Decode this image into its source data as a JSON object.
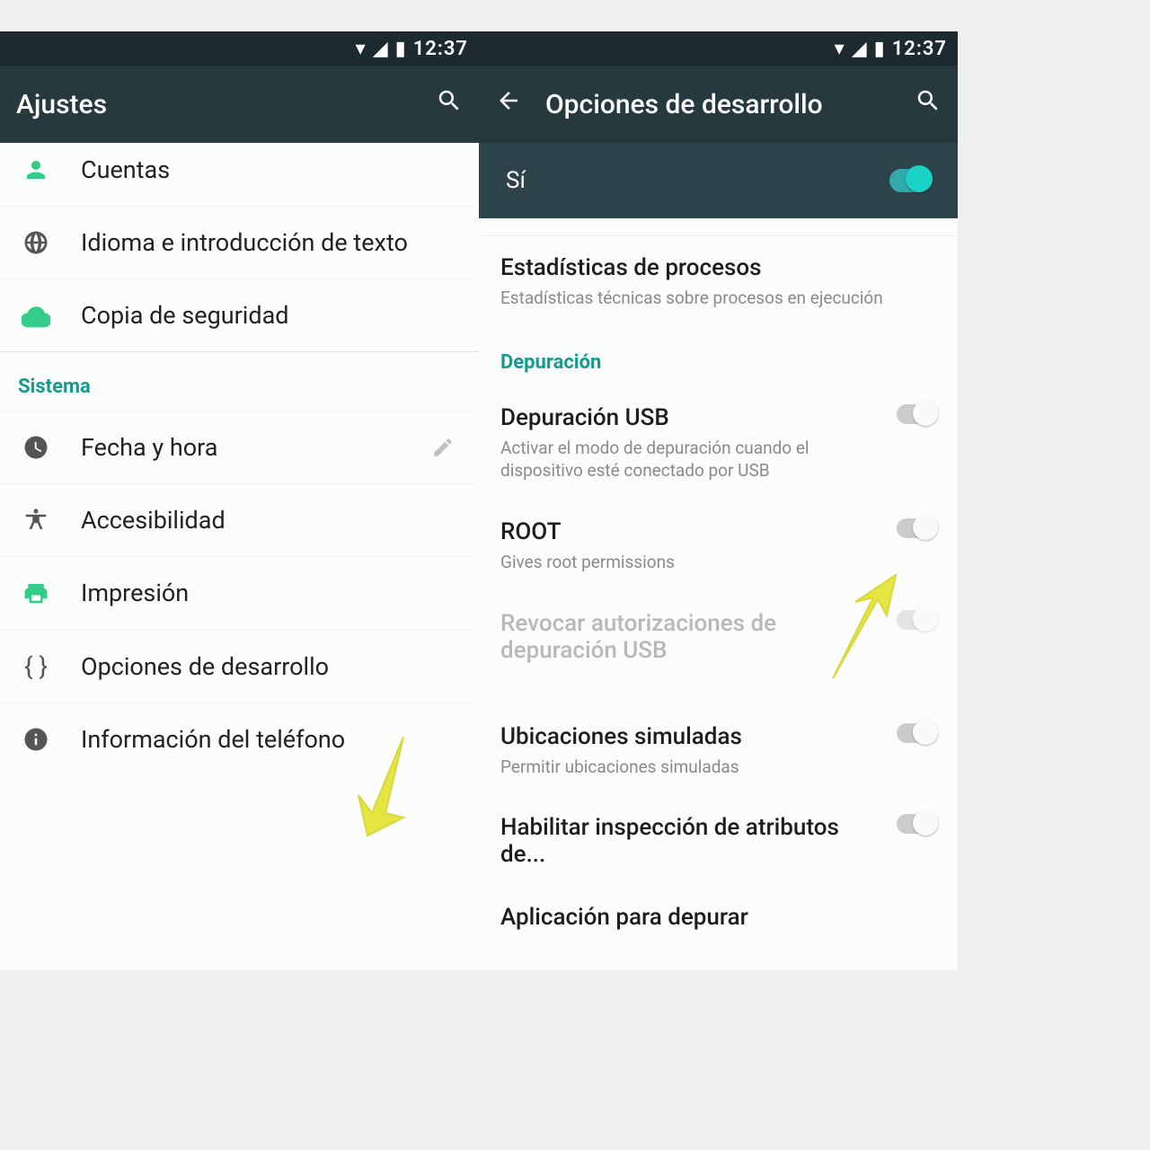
{
  "status": {
    "time": "12:37"
  },
  "left": {
    "title": "Ajustes",
    "rows": {
      "accounts": "Cuentas",
      "language": "Idioma e introducción de texto",
      "backup": "Copia de seguridad",
      "section_system": "Sistema",
      "datetime": "Fecha y hora",
      "accessibility": "Accesibilidad",
      "printing": "Impresión",
      "developer": "Opciones de desarrollo",
      "about": "Información del teléfono"
    }
  },
  "right": {
    "title": "Opciones de desarrollo",
    "master_label": "Sí",
    "rows": {
      "procstats_label": "Estadísticas de procesos",
      "procstats_sub": "Estadísticas técnicas sobre procesos en ejecución",
      "section_debug": "Depuración",
      "usb_label": "Depuración USB",
      "usb_sub": "Activar el modo de depuración cuando el dispositivo esté conectado por USB",
      "root_label": "ROOT",
      "root_sub": "Gives root permissions",
      "revoke_label": "Revocar autorizaciones de depuración USB",
      "revoke_sub": "",
      "mock_label": "Ubicaciones simuladas",
      "mock_sub": "Permitir ubicaciones simuladas",
      "attr_label": "Habilitar inspección de atributos de...",
      "select_app_label": "Aplicación para depurar"
    }
  }
}
